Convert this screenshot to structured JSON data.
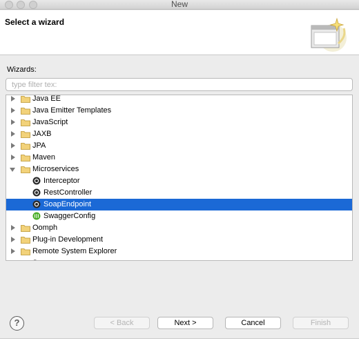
{
  "window": {
    "title": "New"
  },
  "header": {
    "title": "Select a wizard"
  },
  "wizards_label": "Wizards:",
  "filter": {
    "placeholder": "type filter tex:",
    "value": ""
  },
  "tree": [
    {
      "label": "Java EE",
      "type": "folder",
      "expanded": false,
      "level": 0
    },
    {
      "label": "Java Emitter Templates",
      "type": "folder",
      "expanded": false,
      "level": 0
    },
    {
      "label": "JavaScript",
      "type": "folder",
      "expanded": false,
      "level": 0
    },
    {
      "label": "JAXB",
      "type": "folder",
      "expanded": false,
      "level": 0
    },
    {
      "label": "JPA",
      "type": "folder",
      "expanded": false,
      "level": 0
    },
    {
      "label": "Maven",
      "type": "folder",
      "expanded": false,
      "level": 0
    },
    {
      "label": "Microservices",
      "type": "folder",
      "expanded": true,
      "level": 0
    },
    {
      "label": "Interceptor",
      "type": "item",
      "icon": "microservice-icon",
      "level": 1
    },
    {
      "label": "RestController",
      "type": "item",
      "icon": "microservice-icon",
      "level": 1
    },
    {
      "label": "SoapEndpoint",
      "type": "item",
      "icon": "microservice-icon",
      "level": 1,
      "selected": true
    },
    {
      "label": "SwaggerConfig",
      "type": "item",
      "icon": "swagger-icon",
      "level": 1
    },
    {
      "label": "Oomph",
      "type": "folder",
      "expanded": false,
      "level": 0
    },
    {
      "label": "Plug-in Development",
      "type": "folder",
      "expanded": false,
      "level": 0
    },
    {
      "label": "Remote System Explorer",
      "type": "folder",
      "expanded": false,
      "level": 0
    },
    {
      "label": "Server",
      "type": "folder",
      "expanded": false,
      "level": 0
    }
  ],
  "buttons": {
    "help": "?",
    "back": "< Back",
    "next": "Next >",
    "cancel": "Cancel",
    "finish": "Finish"
  },
  "colors": {
    "selection": "#1b69d6",
    "folder": "#f2d27a",
    "swagger": "#4caf2a"
  }
}
